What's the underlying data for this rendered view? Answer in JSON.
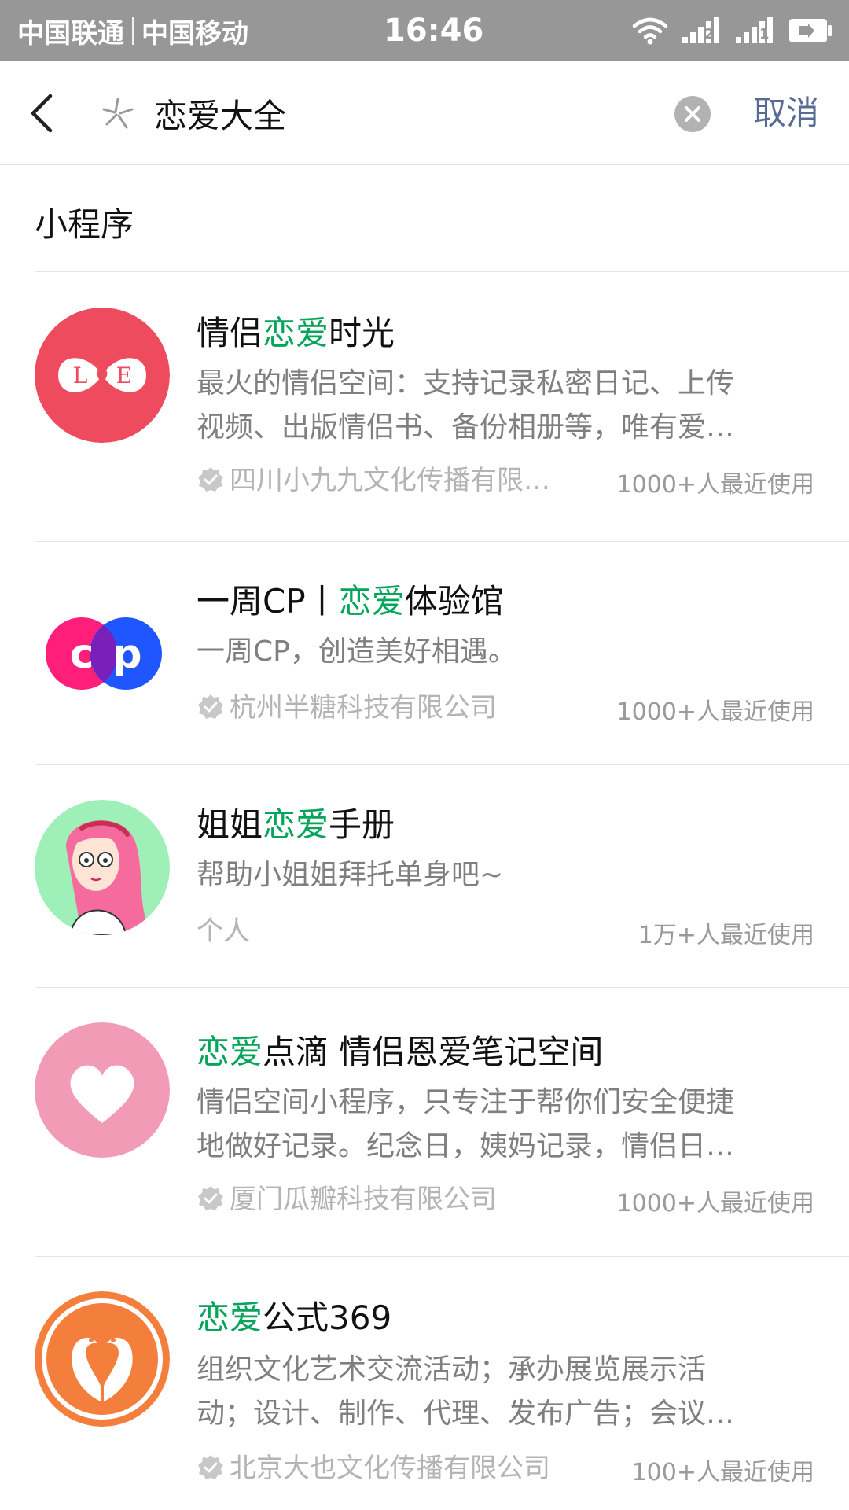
{
  "status_bar": {
    "carrier_1": "中国联通",
    "carrier_2": "中国移动",
    "time": "16:46",
    "sim1_badge": "2",
    "sim2_badge": "1",
    "icons": [
      "wifi-icon",
      "signal-icon",
      "signal-icon",
      "battery-charging-icon"
    ]
  },
  "search": {
    "query": "恋爱大全",
    "cancel_label": "取消"
  },
  "section": {
    "title": "小程序"
  },
  "highlight_color": "#07a55b",
  "link_color": "#576b95",
  "results": [
    {
      "title_pre": "情侣",
      "title_hl": "恋爱",
      "title_post": "时光",
      "desc_line1": "最火的情侣空间：支持记录私密日记、上传",
      "desc_line2": "视频、出版情侣书、备份相册等，唯有爱…",
      "developer": "四川小九九文化传播有限…",
      "usage": "1000+人最近使用",
      "icon_text": "L♥E"
    },
    {
      "title_pre": "一周CP丨",
      "title_hl": "恋爱",
      "title_post": "体验馆",
      "desc_line1": "一周CP，创造美好相遇。",
      "developer": "杭州半糖科技有限公司",
      "usage": "1000+人最近使用",
      "icon_text": "cp"
    },
    {
      "title_pre": "姐姐",
      "title_hl": "恋爱",
      "title_post": "手册",
      "desc_line1": "帮助小姐姐拜托单身吧~",
      "developer": "个人",
      "usage": "1万+人最近使用"
    },
    {
      "title_pre": "",
      "title_hl": "恋爱",
      "title_post": "点滴 情侣恩爱笔记空间",
      "desc_line1": "情侣空间小程序，只专注于帮你们安全便捷",
      "desc_line2": "地做好记录。纪念日，姨妈记录，情侣日…",
      "developer": "厦门瓜瓣科技有限公司",
      "usage": "1000+人最近使用"
    },
    {
      "title_pre": "",
      "title_hl": "恋爱",
      "title_post": "公式369",
      "desc_line1": "组织文化艺术交流活动；承办展览展示活",
      "desc_line2": "动；设计、制作、代理、发布广告；会议…",
      "developer": "北京大也文化传播有限公司",
      "usage": "100+人最近使用"
    }
  ]
}
